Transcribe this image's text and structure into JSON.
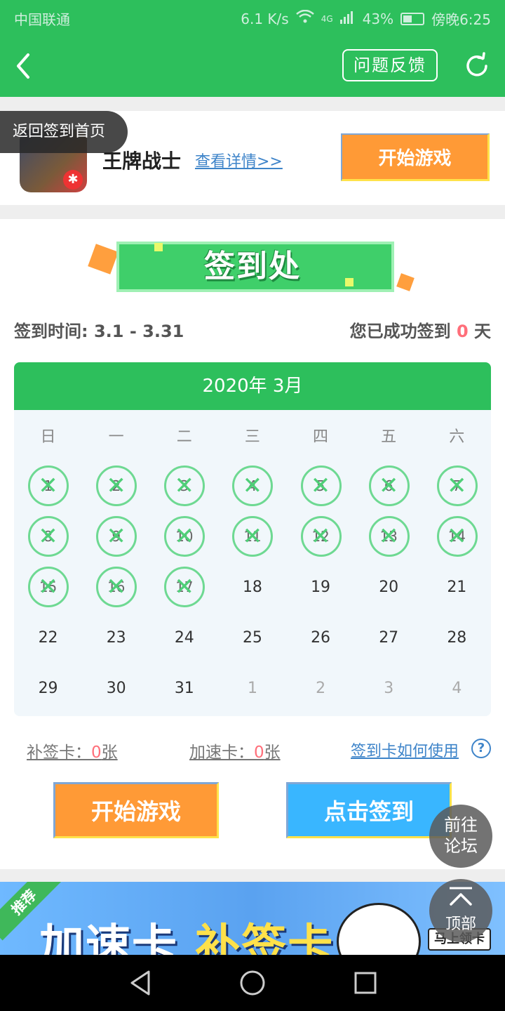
{
  "status_bar": {
    "carrier": "中国联通",
    "speed": "6.1 K/s",
    "network": "4G",
    "battery": "43%",
    "time": "傍晚6:25"
  },
  "header": {
    "feedback_label": "问题反馈",
    "back_icon": "back-arrow-icon",
    "refresh_icon": "refresh-icon"
  },
  "game": {
    "name": "王牌战士",
    "detail_link": "查看详情>>",
    "start_label": "开始游戏"
  },
  "back_home": "返回签到首页",
  "sign_section": {
    "banner_title": "签到处",
    "time_label": "签到时间: 3.1 - 3.31",
    "count_prefix": "您已成功签到",
    "count_value": "0",
    "count_suffix": "天"
  },
  "calendar": {
    "header": "2020年 3月",
    "weekdays": [
      "日",
      "一",
      "二",
      "三",
      "四",
      "五",
      "六"
    ],
    "weeks": [
      [
        {
          "d": "1",
          "s": true
        },
        {
          "d": "2",
          "s": true
        },
        {
          "d": "3",
          "s": true
        },
        {
          "d": "4",
          "s": true
        },
        {
          "d": "5",
          "s": true
        },
        {
          "d": "6",
          "s": true
        },
        {
          "d": "7",
          "s": true
        }
      ],
      [
        {
          "d": "8",
          "s": true
        },
        {
          "d": "9",
          "s": true
        },
        {
          "d": "10",
          "s": true
        },
        {
          "d": "11",
          "s": true
        },
        {
          "d": "12",
          "s": true
        },
        {
          "d": "13",
          "s": true
        },
        {
          "d": "14",
          "s": true
        }
      ],
      [
        {
          "d": "15",
          "s": true
        },
        {
          "d": "16",
          "s": true
        },
        {
          "d": "17",
          "s": true
        },
        {
          "d": "18",
          "s": false
        },
        {
          "d": "19",
          "s": false
        },
        {
          "d": "20",
          "s": false
        },
        {
          "d": "21",
          "s": false
        }
      ],
      [
        {
          "d": "22",
          "s": false
        },
        {
          "d": "23",
          "s": false
        },
        {
          "d": "24",
          "s": false
        },
        {
          "d": "25",
          "s": false
        },
        {
          "d": "26",
          "s": false
        },
        {
          "d": "27",
          "s": false
        },
        {
          "d": "28",
          "s": false
        }
      ],
      [
        {
          "d": "29",
          "s": false
        },
        {
          "d": "30",
          "s": false
        },
        {
          "d": "31",
          "s": false
        },
        {
          "d": "1",
          "s": false,
          "m": true
        },
        {
          "d": "2",
          "s": false,
          "m": true
        },
        {
          "d": "3",
          "s": false,
          "m": true
        },
        {
          "d": "4",
          "s": false,
          "m": true
        }
      ]
    ]
  },
  "cards": {
    "makeup_label": "补签卡：",
    "makeup_count": "0",
    "makeup_unit": "张",
    "speed_label": "加速卡：",
    "speed_count": "0",
    "speed_unit": "张",
    "howto_link": "签到卡如何使用",
    "help_icon": "?"
  },
  "actions": {
    "play_label": "开始游戏",
    "sign_label": "点击签到"
  },
  "promo": {
    "tag": "推荐",
    "text_white": "加速卡",
    "text_yellow": "补签卡",
    "claim": "马上领卡"
  },
  "fab": {
    "forum_line1": "前往",
    "forum_line2": "论坛",
    "top_label": "顶部"
  },
  "colors": {
    "brand_green": "#2dbf5c",
    "orange": "#ff9a36",
    "blue": "#39b6ff",
    "highlight_red": "#ff6f7a"
  }
}
